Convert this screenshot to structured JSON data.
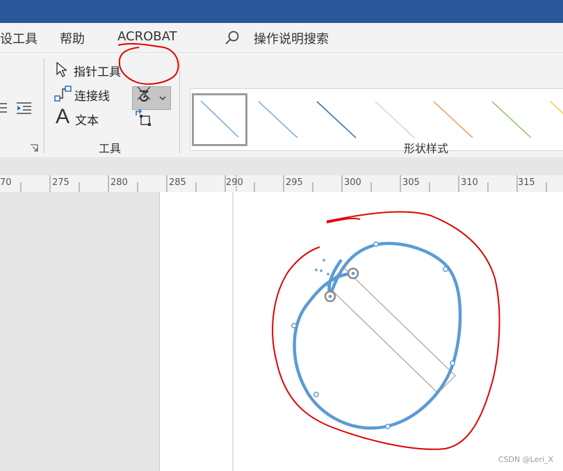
{
  "menu_tabs": {
    "design_tools_partial": "设工具",
    "help": "帮助",
    "acrobat": "ACROBAT"
  },
  "search": {
    "icon": "search-icon",
    "label": "操作说明搜索"
  },
  "tools_group": {
    "pointer_tool": "指针工具",
    "connector": "连接线",
    "text": "文本",
    "group_label": "工具",
    "freeform_dropdown_glyph": "ᘔ"
  },
  "shape_styles": {
    "group_label": "形状样式",
    "swatch_colors": [
      "#7fb0e0",
      "#7fb0e0",
      "#3d6fa8",
      "#c9dbf0",
      "#f0a060",
      "#8cc870",
      "#f5d040"
    ]
  },
  "ruler": {
    "labels": [
      "70",
      "275",
      "280",
      "285",
      "290",
      "295",
      "300",
      "305",
      "310",
      "315"
    ]
  },
  "drawing": {
    "shape_color": "#5b9bd5",
    "annotation_color": "#e00000"
  },
  "watermark": "CSDN @Leri_X"
}
